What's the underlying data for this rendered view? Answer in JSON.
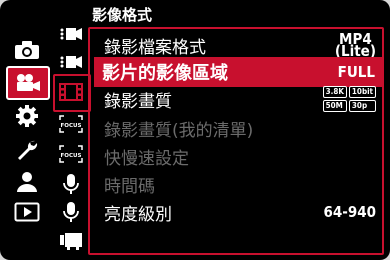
{
  "title": "影像格式",
  "rail": [
    {
      "name": "photo",
      "active": false
    },
    {
      "name": "video",
      "active": true
    },
    {
      "name": "custom",
      "active": false
    },
    {
      "name": "setup",
      "active": false
    },
    {
      "name": "my-menu",
      "active": false
    },
    {
      "name": "playback",
      "active": false
    }
  ],
  "tabs": [
    {
      "icon": "film-stack-icon"
    },
    {
      "icon": "film-stack-icon"
    },
    {
      "icon": "film-strip-icon",
      "active": true
    },
    {
      "icon": "focus-icon",
      "label": "FOCUS"
    },
    {
      "icon": "focus-icon",
      "label": "FOCUS"
    },
    {
      "icon": "microphone-icon"
    },
    {
      "icon": "microphone-icon"
    },
    {
      "icon": "monitor-icon"
    }
  ],
  "menu": {
    "items": [
      {
        "label": "錄影檔案格式",
        "value_top": "MP4",
        "value_bottom": "(Lite)"
      },
      {
        "label": "影片的影像區域",
        "value": "FULL"
      },
      {
        "label": "錄影畫質",
        "badges": [
          "3.8K",
          "10bit",
          "50M",
          "30p"
        ]
      },
      {
        "label": "錄影畫質(我的清單)"
      },
      {
        "label": "快慢速設定"
      },
      {
        "label": "時間碼"
      },
      {
        "label": "亮度級別",
        "value": "64-940"
      }
    ]
  },
  "colors": {
    "accent": "#c8102e",
    "dim": "#6b6b6b"
  }
}
